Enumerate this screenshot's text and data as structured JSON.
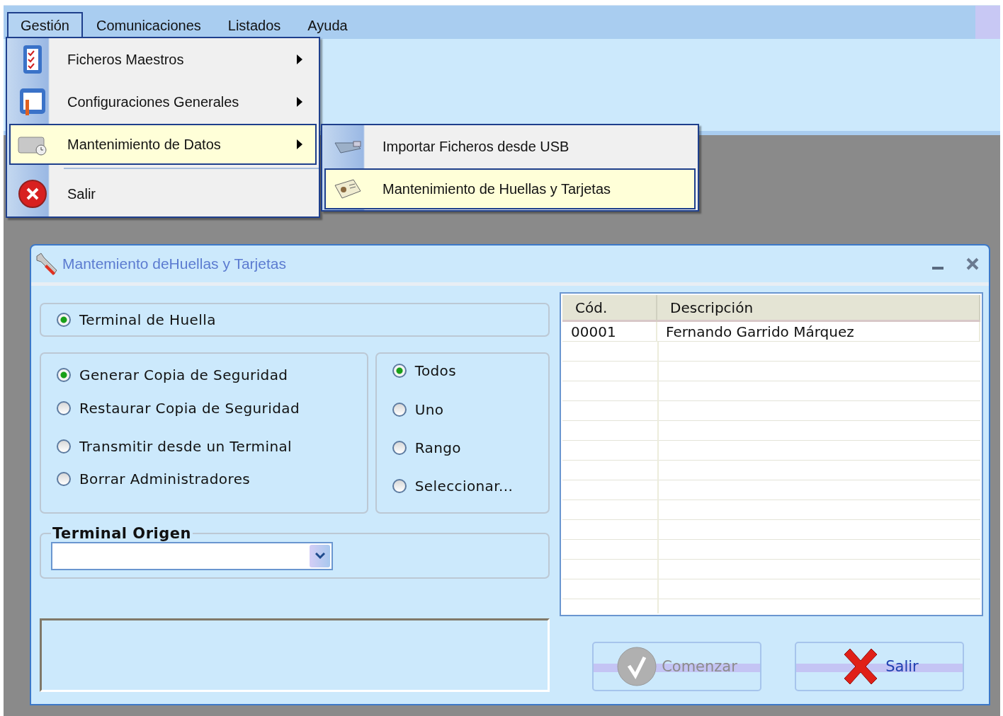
{
  "menubar": {
    "items": [
      {
        "label": "Gestión",
        "selected": true
      },
      {
        "label": "Comunicaciones",
        "selected": false
      },
      {
        "label": "Listados",
        "selected": false
      },
      {
        "label": "Ayuda",
        "selected": false
      }
    ]
  },
  "menu": {
    "items": [
      {
        "label": "Ficheros Maestros",
        "has_submenu": true,
        "selected": false,
        "separator_before": false
      },
      {
        "label": "Configuraciones Generales",
        "has_submenu": true,
        "selected": false,
        "separator_before": false
      },
      {
        "label": "Mantenimiento de Datos",
        "has_submenu": true,
        "selected": true,
        "separator_before": false
      },
      {
        "label": "Salir",
        "has_submenu": false,
        "selected": false,
        "separator_before": true
      }
    ]
  },
  "submenu": {
    "items": [
      {
        "label": "Importar Ficheros desde USB",
        "selected": false
      },
      {
        "label": "Mantenimiento de Huellas y Tarjetas",
        "selected": true
      }
    ]
  },
  "dialog": {
    "title": "Mantemiento deHuellas y Tarjetas",
    "device_group": {
      "options": [
        {
          "label": "Terminal de Huella",
          "selected": true
        }
      ]
    },
    "operation_group": {
      "options": [
        {
          "label": "Generar Copia de Seguridad",
          "selected": true
        },
        {
          "label": "Restaurar Copia de Seguridad",
          "selected": false
        },
        {
          "label": "Transmitir desde un Terminal",
          "selected": false
        },
        {
          "label": "Borrar Administradores",
          "selected": false
        }
      ]
    },
    "scope_group": {
      "options": [
        {
          "label": "Todos",
          "selected": true
        },
        {
          "label": "Uno",
          "selected": false
        },
        {
          "label": "Rango",
          "selected": false
        },
        {
          "label": "Seleccionar...",
          "selected": false
        }
      ]
    },
    "terminal_origen": {
      "label": "Terminal Origen"
    },
    "table": {
      "columns": [
        "Cód.",
        "Descripción"
      ],
      "rows": [
        [
          "00001",
          "Fernando Garrido Márquez"
        ]
      ]
    },
    "buttons": [
      {
        "label": "Comenzar",
        "disabled": true
      },
      {
        "label": "Salir",
        "disabled": false
      }
    ]
  }
}
